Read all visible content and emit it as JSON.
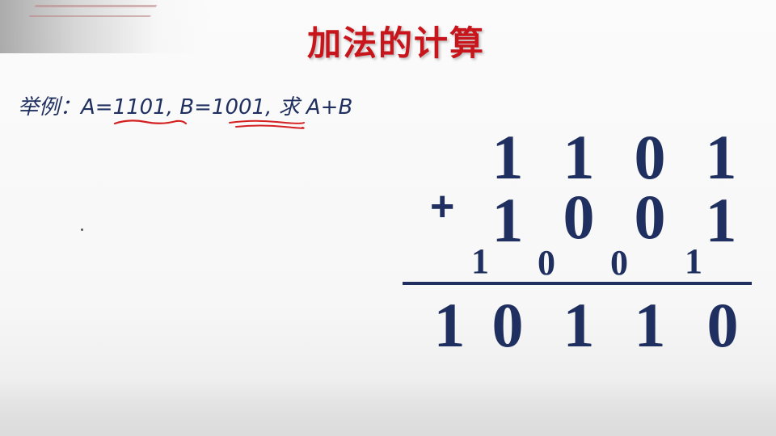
{
  "slide": {
    "title": "加法的计算",
    "example": {
      "prefix": "举例：",
      "a_label": "A=",
      "a_value": "1101",
      "sep": ",",
      "b_label": "B=",
      "b_value": "1001",
      "suffix": ", 求 A+B"
    },
    "calc": {
      "addend1": [
        "1",
        "1",
        "0",
        "1"
      ],
      "operator": "+",
      "addend2": [
        "1",
        "0",
        "0",
        "1"
      ],
      "carry": [
        "1",
        "0",
        "0",
        "1"
      ],
      "result": [
        "1",
        "0",
        "1",
        "1",
        "0"
      ]
    },
    "colors": {
      "title": "#c8151b",
      "text": "#1f2f5f",
      "annotation": "#d42020"
    }
  }
}
